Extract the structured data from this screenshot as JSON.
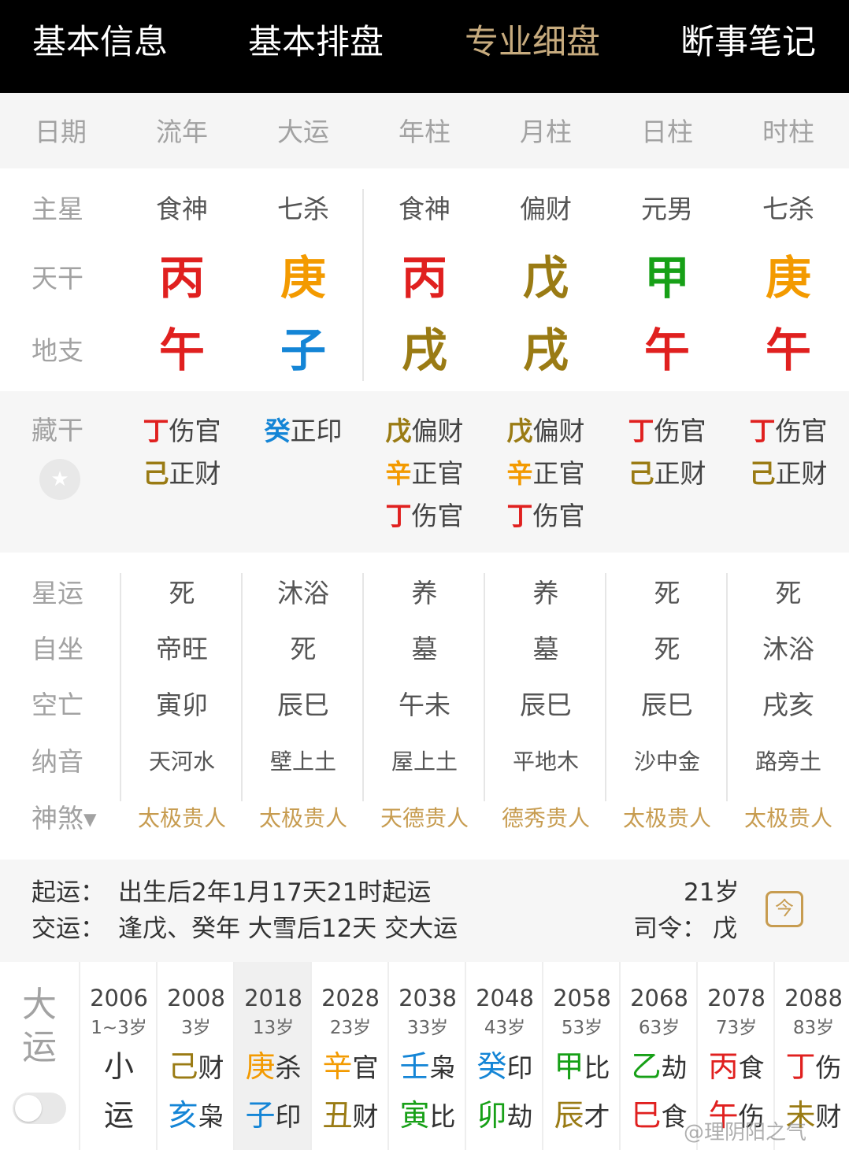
{
  "tabs": [
    "基本信息",
    "基本排盘",
    "专业细盘",
    "断事笔记"
  ],
  "active_tab": 2,
  "columns": [
    "日期",
    "流年",
    "大运",
    "年柱",
    "月柱",
    "日柱",
    "时柱"
  ],
  "labels": {
    "zhuxing": "主星",
    "tiangan": "天干",
    "dizhi": "地支",
    "canggan": "藏干",
    "xingyun": "星运",
    "zizuo": "自坐",
    "kongwang": "空亡",
    "nayin": "纳音",
    "shensha": "神煞▾"
  },
  "zhuxing": [
    "食神",
    "七杀",
    "食神",
    "偏财",
    "元男",
    "七杀"
  ],
  "tiangan": [
    {
      "char": "丙",
      "el": "fire"
    },
    {
      "char": "庚",
      "el": "metal"
    },
    {
      "char": "丙",
      "el": "fire"
    },
    {
      "char": "戊",
      "el": "earth"
    },
    {
      "char": "甲",
      "el": "wood"
    },
    {
      "char": "庚",
      "el": "metal"
    }
  ],
  "dizhi": [
    {
      "char": "午",
      "el": "fire"
    },
    {
      "char": "子",
      "el": "water"
    },
    {
      "char": "戌",
      "el": "earth"
    },
    {
      "char": "戌",
      "el": "earth"
    },
    {
      "char": "午",
      "el": "fire"
    },
    {
      "char": "午",
      "el": "fire"
    }
  ],
  "canggan": [
    [
      {
        "g": "丁",
        "el": "fire",
        "t": "伤官"
      },
      {
        "g": "己",
        "el": "earth",
        "t": "正财"
      }
    ],
    [
      {
        "g": "癸",
        "el": "water",
        "t": "正印"
      }
    ],
    [
      {
        "g": "戊",
        "el": "earth",
        "t": "偏财"
      },
      {
        "g": "辛",
        "el": "metal",
        "t": "正官"
      },
      {
        "g": "丁",
        "el": "fire",
        "t": "伤官"
      }
    ],
    [
      {
        "g": "戊",
        "el": "earth",
        "t": "偏财"
      },
      {
        "g": "辛",
        "el": "metal",
        "t": "正官"
      },
      {
        "g": "丁",
        "el": "fire",
        "t": "伤官"
      }
    ],
    [
      {
        "g": "丁",
        "el": "fire",
        "t": "伤官"
      },
      {
        "g": "己",
        "el": "earth",
        "t": "正财"
      }
    ],
    [
      {
        "g": "丁",
        "el": "fire",
        "t": "伤官"
      },
      {
        "g": "己",
        "el": "earth",
        "t": "正财"
      }
    ]
  ],
  "xingyun": [
    "死",
    "沐浴",
    "养",
    "养",
    "死",
    "死"
  ],
  "zizuo": [
    "帝旺",
    "死",
    "墓",
    "墓",
    "死",
    "沐浴"
  ],
  "kongwang": [
    "寅卯",
    "辰巳",
    "午未",
    "辰巳",
    "辰巳",
    "戌亥"
  ],
  "nayin": [
    "天河水",
    "壁上土",
    "屋上土",
    "平地木",
    "沙中金",
    "路旁土"
  ],
  "shensha": [
    "太极贵人",
    "太极贵人",
    "天德贵人",
    "德秀贵人",
    "太极贵人",
    "太极贵人"
  ],
  "qiyun": {
    "label1": "起运：",
    "text1": "出生后2年1月17天21时起运",
    "label2": "交运：",
    "text2": "逢戊、癸年 大雪后12天 交大运",
    "age": "21岁",
    "siling_label": "司令：",
    "siling_value": "戊",
    "calendar_icon_glyph": "今"
  },
  "dayun": {
    "label": "大运",
    "items": [
      {
        "year": "2006",
        "age": "1~3岁",
        "top": {
          "g": "小",
          "s": "",
          "el": "plain"
        },
        "bot": {
          "g": "运",
          "s": "",
          "el": "plain"
        }
      },
      {
        "year": "2008",
        "age": "3岁",
        "top": {
          "g": "己",
          "s": "财",
          "el": "earth"
        },
        "bot": {
          "g": "亥",
          "s": "枭",
          "el": "water"
        }
      },
      {
        "year": "2018",
        "age": "13岁",
        "top": {
          "g": "庚",
          "s": "杀",
          "el": "metal"
        },
        "bot": {
          "g": "子",
          "s": "印",
          "el": "water"
        }
      },
      {
        "year": "2028",
        "age": "23岁",
        "top": {
          "g": "辛",
          "s": "官",
          "el": "metal"
        },
        "bot": {
          "g": "丑",
          "s": "财",
          "el": "earth"
        }
      },
      {
        "year": "2038",
        "age": "33岁",
        "top": {
          "g": "壬",
          "s": "枭",
          "el": "water"
        },
        "bot": {
          "g": "寅",
          "s": "比",
          "el": "wood"
        }
      },
      {
        "year": "2048",
        "age": "43岁",
        "top": {
          "g": "癸",
          "s": "印",
          "el": "water"
        },
        "bot": {
          "g": "卯",
          "s": "劫",
          "el": "wood"
        }
      },
      {
        "year": "2058",
        "age": "53岁",
        "top": {
          "g": "甲",
          "s": "比",
          "el": "wood"
        },
        "bot": {
          "g": "辰",
          "s": "才",
          "el": "earth"
        }
      },
      {
        "year": "2068",
        "age": "63岁",
        "top": {
          "g": "乙",
          "s": "劫",
          "el": "wood"
        },
        "bot": {
          "g": "巳",
          "s": "食",
          "el": "fire"
        }
      },
      {
        "year": "2078",
        "age": "73岁",
        "top": {
          "g": "丙",
          "s": "食",
          "el": "fire"
        },
        "bot": {
          "g": "午",
          "s": "伤",
          "el": "fire"
        }
      },
      {
        "year": "2088",
        "age": "83岁",
        "top": {
          "g": "丁",
          "s": "伤",
          "el": "fire"
        },
        "bot": {
          "g": "未",
          "s": "财",
          "el": "earth"
        }
      }
    ],
    "active_index": 2
  },
  "watermark": "@理阴阳之气",
  "colors": {
    "fire": "#e0201f",
    "metal": "#f39a00",
    "earth": "#9a7b14",
    "wood": "#17a017",
    "water": "#1485d6",
    "accent": "#c7ab7e"
  }
}
